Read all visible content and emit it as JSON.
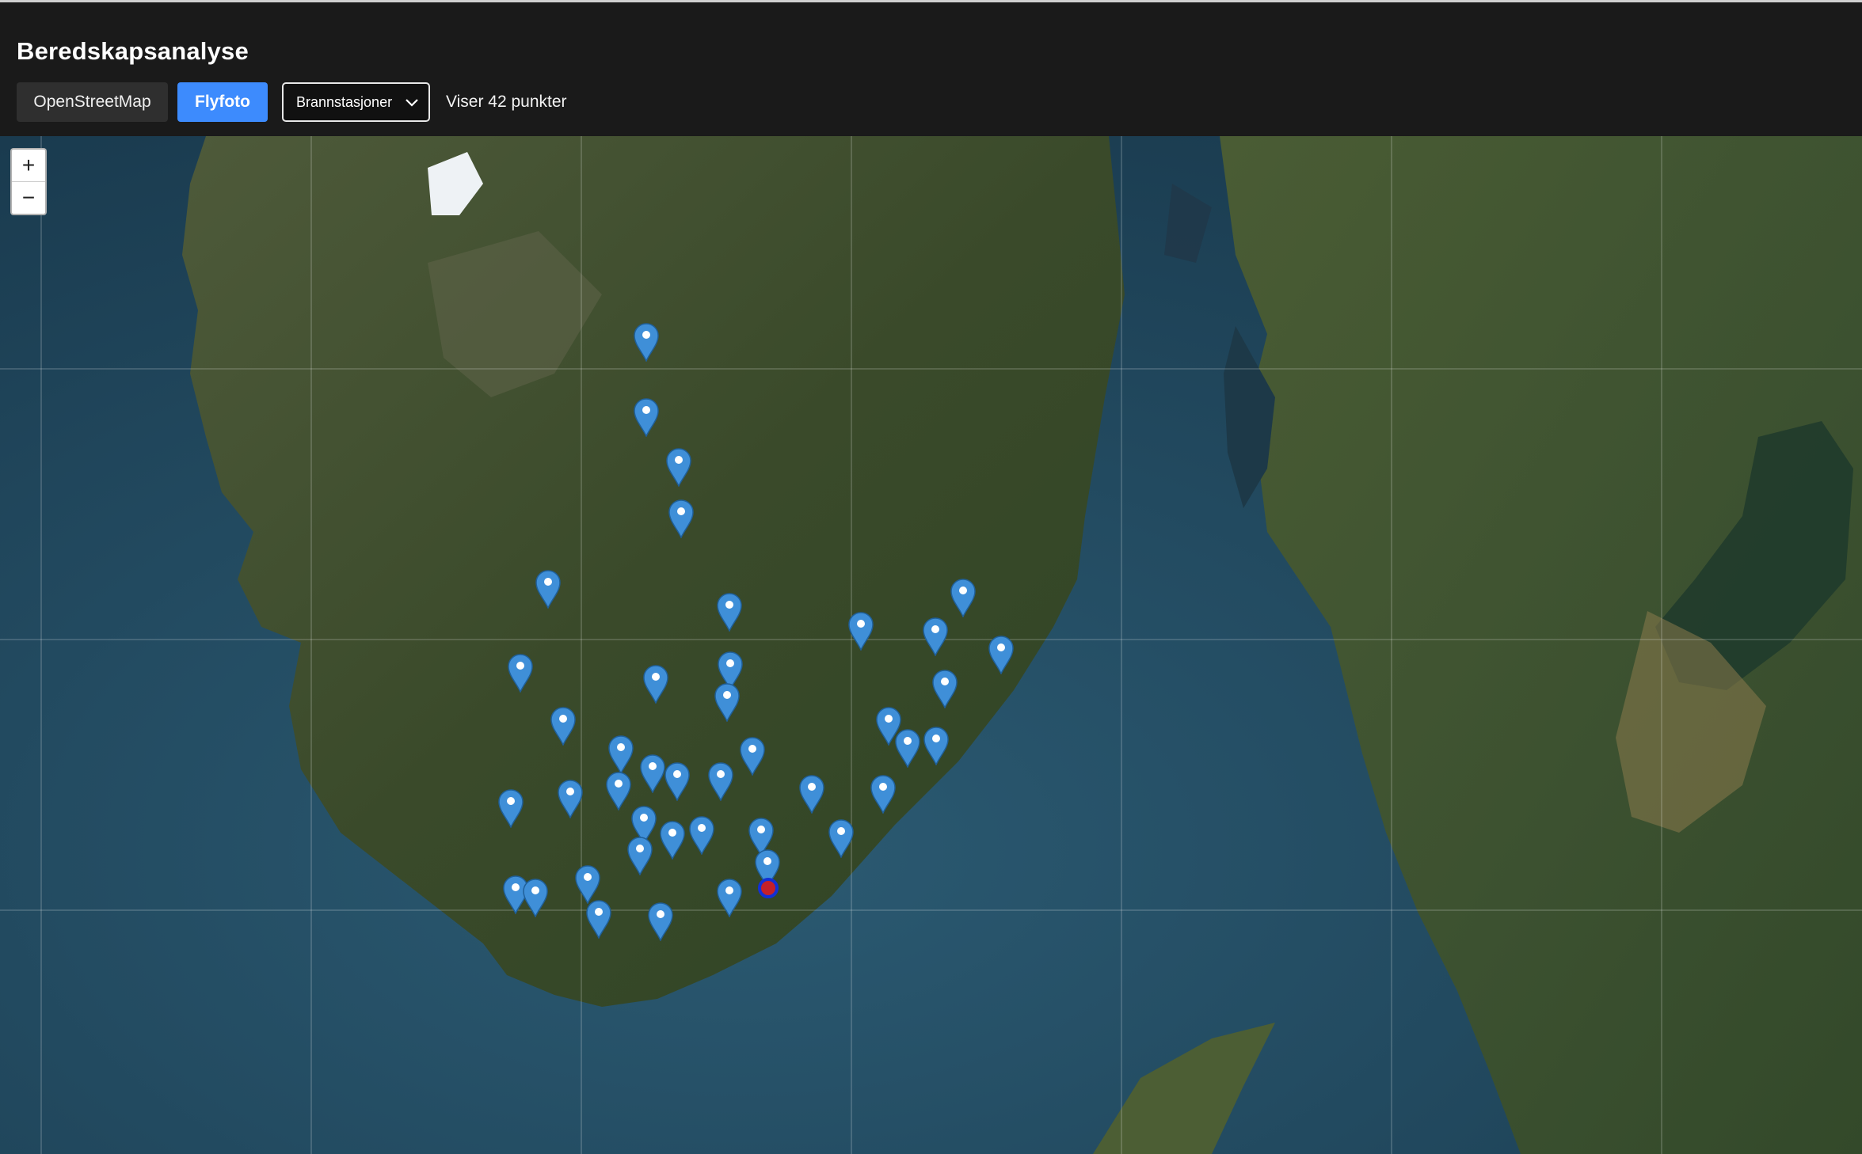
{
  "header": {
    "title": "Beredskapsanalyse",
    "layer_buttons": {
      "osm_label": "OpenStreetMap",
      "photo_label": "Flyfoto",
      "active": "Flyfoto",
      "active_color": "#3d8bfd"
    },
    "dataset_select": {
      "selected": "Brannstasjoner"
    },
    "status_text": "Viser 42 punkter"
  },
  "map": {
    "basemap": "Flyfoto",
    "zoom_in_label": "+",
    "zoom_out_label": "−",
    "marker_color": "#3f8fd8",
    "selected_marker_color": "#c4202a",
    "markers_shown": 42
  }
}
